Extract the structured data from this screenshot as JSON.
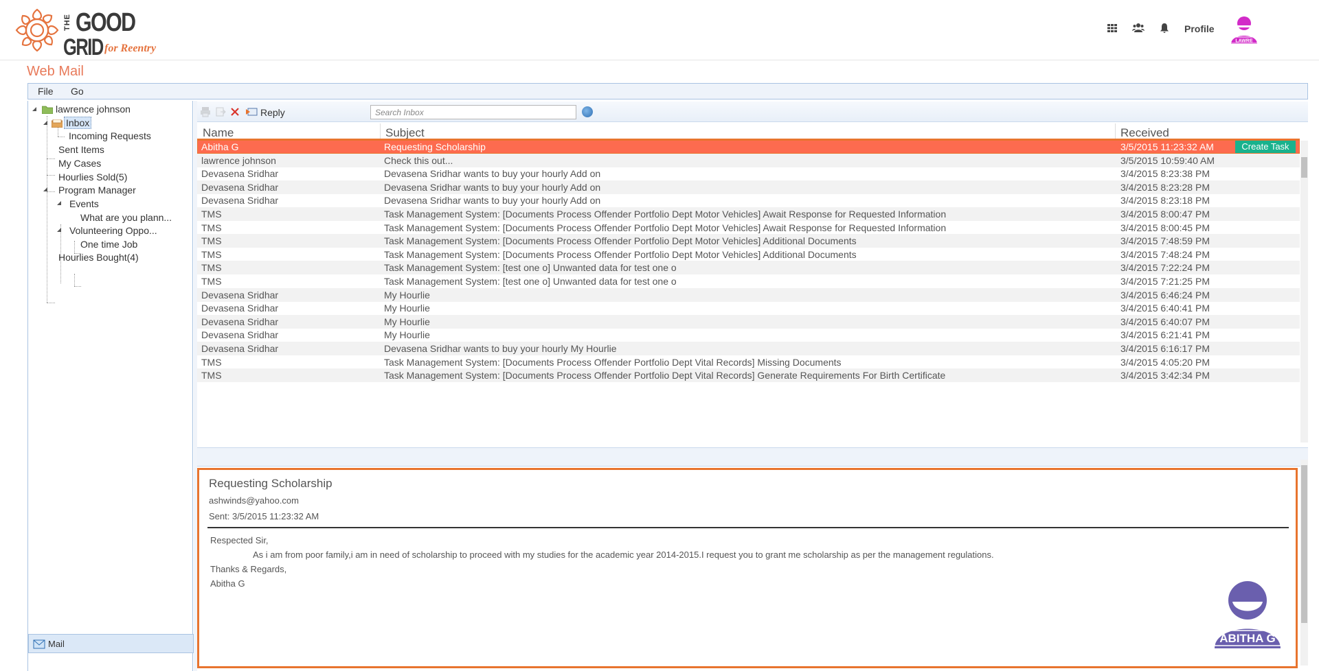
{
  "header": {
    "logo_the": "THE",
    "logo_good": "GOOD",
    "logo_grid": "GRID",
    "logo_tagline": "for Reentry",
    "icons": [
      "apps-grid-icon",
      "users-icon",
      "bell-icon"
    ],
    "profile_label": "Profile",
    "avatar_text": "LAWRE",
    "avatar_color": "#d22bc8"
  },
  "page": {
    "title": "Web Mail",
    "title_color": "#e87a5a"
  },
  "menu": {
    "file": "File",
    "go": "Go"
  },
  "tree": {
    "root": "lawrence johnson",
    "inbox": "Inbox",
    "incoming": "Incoming Requests",
    "sent": "Sent Items",
    "cases": "My Cases",
    "hourlies_sold": "Hourlies Sold(5)",
    "program_manager": "Program Manager",
    "events": "Events",
    "event_item": "What are you plann...",
    "volunteering": "Volunteering Oppo...",
    "one_time_job": "One time Job",
    "hourlies_bought": "Hourlies Bought(4)",
    "mail_tab": "Mail"
  },
  "toolbar": {
    "reply": "Reply",
    "search_placeholder": "Search Inbox"
  },
  "grid": {
    "columns": {
      "name": "Name",
      "subject": "Subject",
      "received": "Received"
    },
    "create_task_label": "Create Task",
    "selected_color": "#fd6b4f",
    "rows": [
      {
        "name": "Abitha G",
        "subject": "Requesting Scholarship",
        "received": "3/5/2015 11:23:32 AM"
      },
      {
        "name": "lawrence johnson",
        "subject": "Check this out...",
        "received": "3/5/2015 10:59:40 AM"
      },
      {
        "name": "Devasena Sridhar",
        "subject": "Devasena Sridhar wants to buy your hourly Add on",
        "received": "3/4/2015 8:23:38 PM"
      },
      {
        "name": "Devasena Sridhar",
        "subject": "Devasena Sridhar wants to buy your hourly Add on",
        "received": "3/4/2015 8:23:28 PM"
      },
      {
        "name": "Devasena Sridhar",
        "subject": "Devasena Sridhar wants to buy your hourly Add on",
        "received": "3/4/2015 8:23:18 PM"
      },
      {
        "name": "TMS",
        "subject": "Task Management System: [Documents Process Offender Portfolio Dept Motor Vehicles] Await Response for Requested Information",
        "received": "3/4/2015 8:00:47 PM"
      },
      {
        "name": "TMS",
        "subject": "Task Management System: [Documents Process Offender Portfolio Dept Motor Vehicles] Await Response for Requested Information",
        "received": "3/4/2015 8:00:45 PM"
      },
      {
        "name": "TMS",
        "subject": "Task Management System: [Documents Process Offender Portfolio Dept Motor Vehicles] Additional Documents",
        "received": "3/4/2015 7:48:59 PM"
      },
      {
        "name": "TMS",
        "subject": "Task Management System: [Documents Process Offender Portfolio Dept Motor Vehicles] Additional Documents",
        "received": "3/4/2015 7:48:24 PM"
      },
      {
        "name": "TMS",
        "subject": "Task Management System: [test one o] Unwanted data for test one o",
        "received": "3/4/2015 7:22:24 PM"
      },
      {
        "name": "TMS",
        "subject": "Task Management System: [test one o] Unwanted data for test one o",
        "received": "3/4/2015 7:21:25 PM"
      },
      {
        "name": "Devasena Sridhar",
        "subject": "My Hourlie",
        "received": "3/4/2015 6:46:24 PM"
      },
      {
        "name": "Devasena Sridhar",
        "subject": "My Hourlie",
        "received": "3/4/2015 6:40:41 PM"
      },
      {
        "name": "Devasena Sridhar",
        "subject": "My Hourlie",
        "received": "3/4/2015 6:40:07 PM"
      },
      {
        "name": "Devasena Sridhar",
        "subject": "My Hourlie",
        "received": "3/4/2015 6:21:41 PM"
      },
      {
        "name": "Devasena Sridhar",
        "subject": "Devasena Sridhar wants to buy your hourly My Hourlie",
        "received": "3/4/2015 6:16:17 PM"
      },
      {
        "name": "TMS",
        "subject": "Task Management System: [Documents Process Offender Portfolio Dept Vital Records] Missing Documents",
        "received": "3/4/2015 4:05:20 PM"
      },
      {
        "name": "TMS",
        "subject": "Task Management System: [Documents Process Offender Portfolio Dept Vital Records] Generate Requirements For Birth Certificate",
        "received": "3/4/2015 3:42:34 PM"
      }
    ]
  },
  "preview": {
    "subject": "Requesting Scholarship",
    "from": "ashwinds@yahoo.com",
    "sent": "Sent: 3/5/2015 11:23:32 AM",
    "greeting": "Respected Sir,",
    "body": "As i am from poor family,i am in need of scholarship to proceed with my studies for the academic year 2014-2015.I request you to grant me scholarship as per the management regulations.",
    "closing": "Thanks & Regards,",
    "signature": "Abitha G",
    "avatar_text": "ABITHA G",
    "avatar_color": "#6a5fae"
  }
}
